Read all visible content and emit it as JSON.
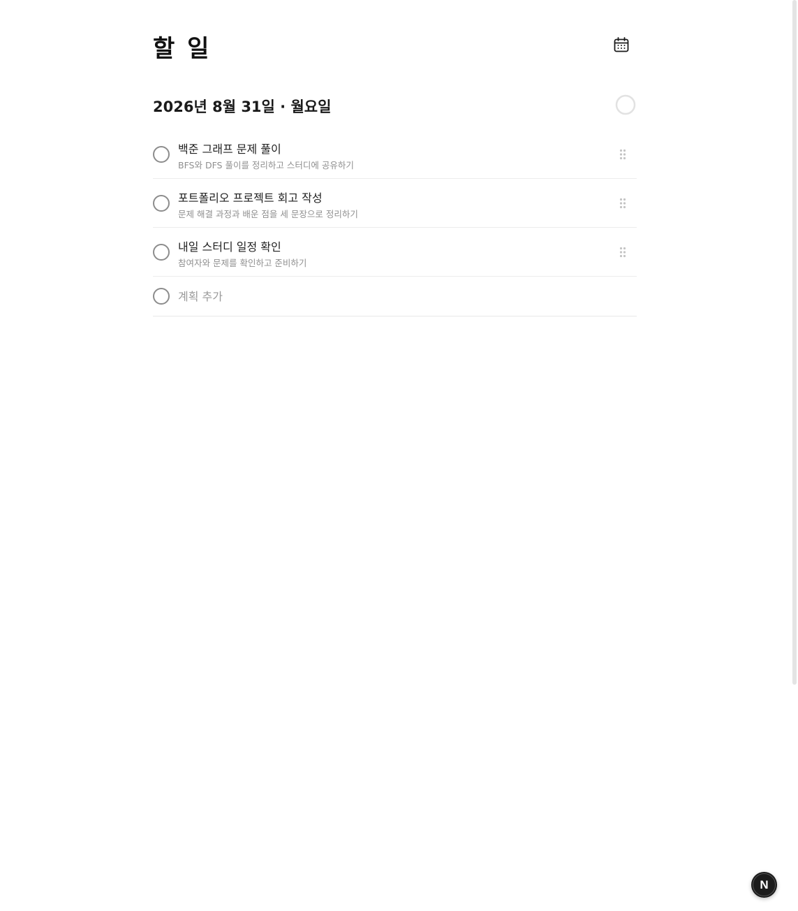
{
  "header": {
    "title": "할 일",
    "calendar_icon": "calendar-icon"
  },
  "date_section": {
    "date_label": "2026년 8월 31일 · 월요일",
    "progress_icon": "progress-ring-icon"
  },
  "tasks": [
    {
      "title": "백준 그래프 문제 풀이",
      "description": "BFS와 DFS 풀이를 정리하고 스터디에 공유하기"
    },
    {
      "title": "포트폴리오 프로젝트 회고 작성",
      "description": "문제 해결 과정과 배운 점을 세 문장으로 정리하기"
    },
    {
      "title": "내일 스터디 일정 확인",
      "description": "참여자와 문제를 확인하고 준비하기"
    }
  ],
  "add_task": {
    "placeholder": "계획 추가",
    "value": ""
  },
  "fab": {
    "label": "N",
    "icon": "next-logo-icon"
  },
  "colors": {
    "background": "#ffffff",
    "text_primary": "#111111",
    "text_secondary": "#8f8f8f",
    "divider": "#ececec",
    "fab_bg": "#1c1c1c"
  }
}
